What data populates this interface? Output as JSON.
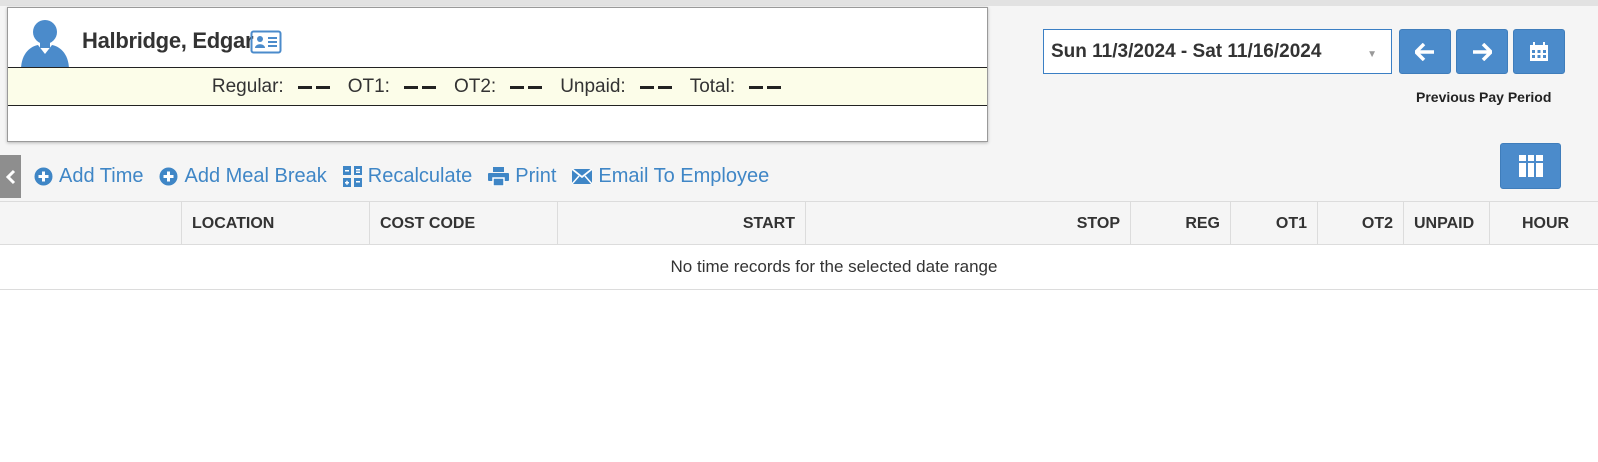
{
  "employee": {
    "name": "Halbridge, Edgar",
    "icons": {
      "avatar": "user-silhouette-icon",
      "profile": "id-card-icon"
    }
  },
  "summary": [
    {
      "label": "Regular:",
      "value": "——"
    },
    {
      "label": "OT1:",
      "value": "——"
    },
    {
      "label": "OT2:",
      "value": "——"
    },
    {
      "label": "Unpaid:",
      "value": "——"
    },
    {
      "label": "Total:",
      "value": "——"
    }
  ],
  "period": {
    "selected": "Sun 11/3/2024 - Sat 11/16/2024",
    "previous_label": "Previous Pay Period",
    "icons": {
      "prev": "arrow-left-icon",
      "next": "arrow-right-icon",
      "calendar": "calendar-icon"
    }
  },
  "toolbar": {
    "add_time": "Add Time",
    "add_meal_break": "Add Meal Break",
    "recalculate": "Recalculate",
    "print": "Print",
    "email": "Email To Employee"
  },
  "table": {
    "columns": [
      "LOCATION",
      "COST CODE",
      "START",
      "STOP",
      "REG",
      "OT1",
      "OT2",
      "UNPAID",
      "HOUR"
    ],
    "empty_message": "No time records for the selected date range"
  },
  "colors": {
    "accent": "#4b8bcb",
    "link": "#3f86c6",
    "summary_bg": "#fcfde9"
  }
}
